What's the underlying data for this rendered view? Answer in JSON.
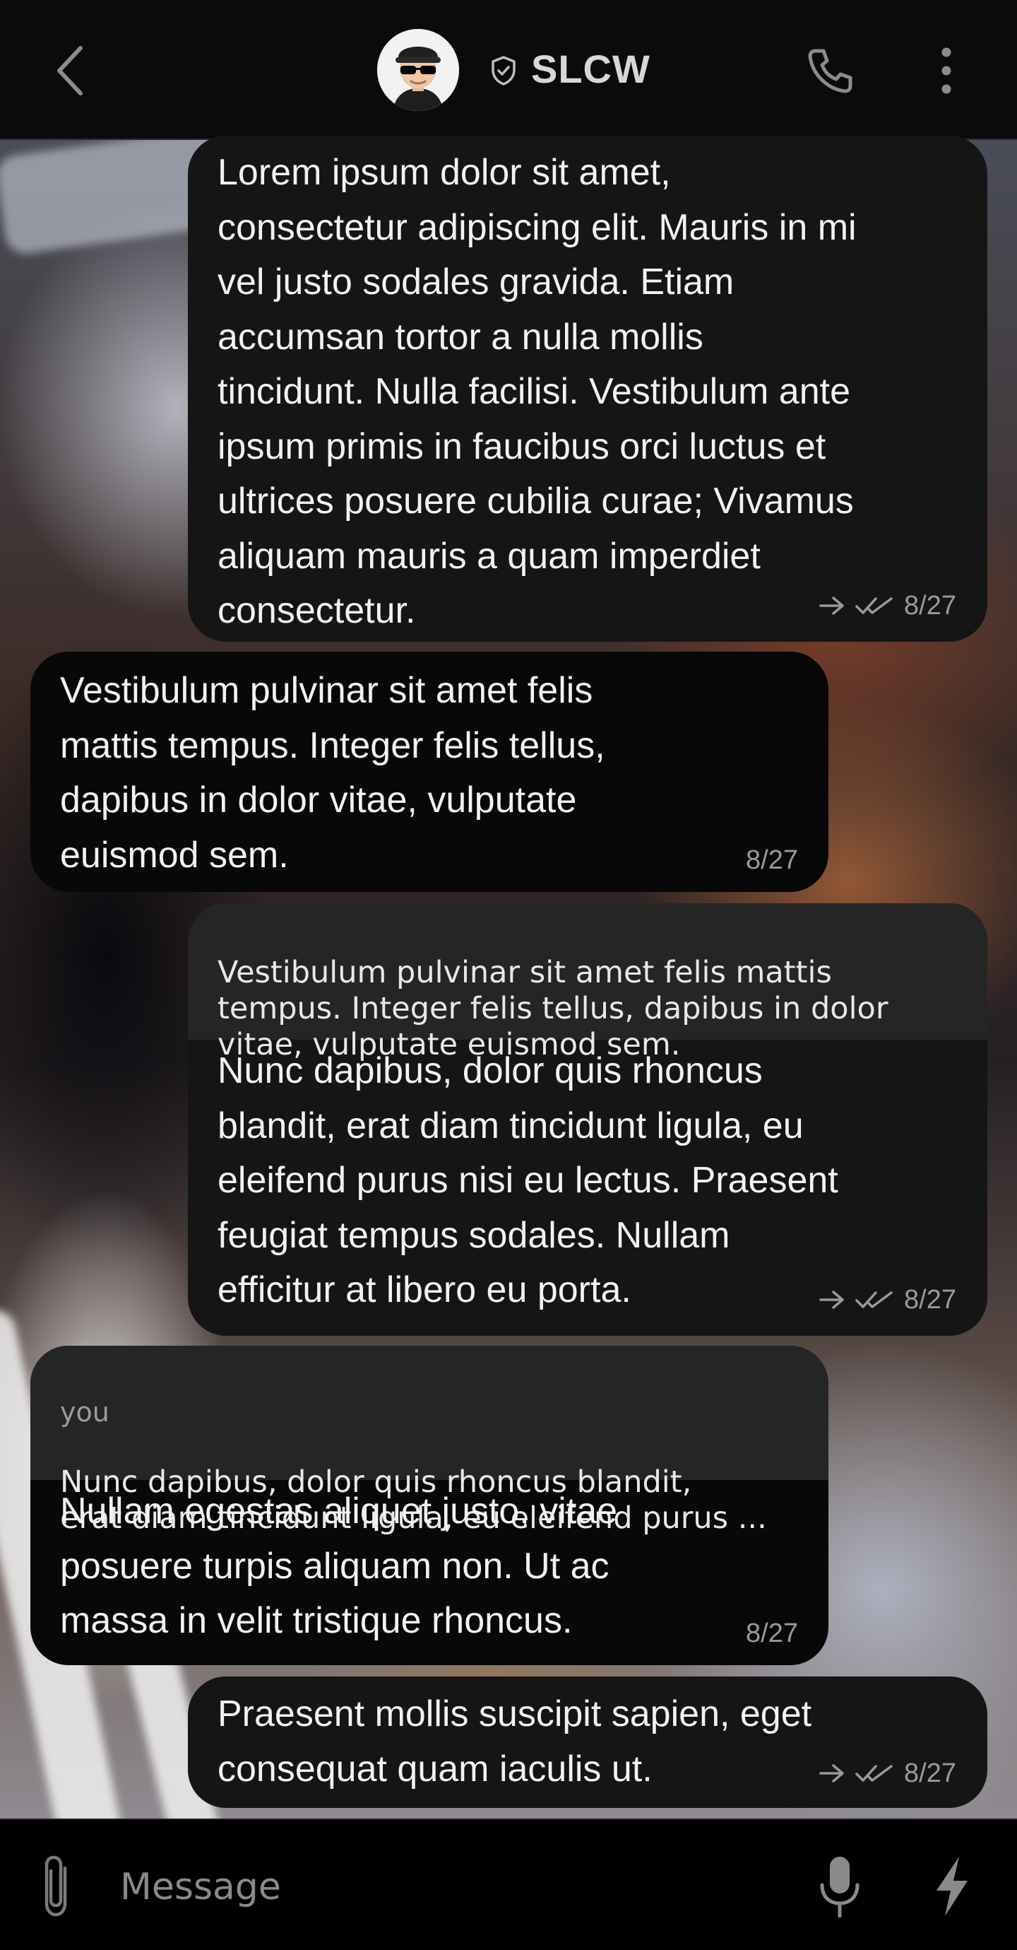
{
  "header": {
    "contact_name": "SLCW",
    "icons": {
      "back": "chevron-left-icon",
      "verified": "shield-check-icon",
      "call": "phone-icon",
      "menu": "more-vertical-icon"
    }
  },
  "messages": [
    {
      "direction": "outgoing",
      "text": "Lorem ipsum dolor sit amet,\nconsectetur adipiscing elit. Mauris in mi\nvel justo sodales gravida. Etiam\naccumsan tortor a nulla mollis\ntincidunt. Nulla facilisi. Vestibulum ante\nipsum primis in faucibus orci luctus et\nultrices posuere cubilia curae; Vivamus\naliquam mauris a quam imperdiet\nconsectetur.",
      "date": "8/27",
      "status": "read"
    },
    {
      "direction": "incoming",
      "text": "Vestibulum pulvinar sit amet felis\nmattis tempus. Integer felis tellus,\ndapibus in dolor vitae, vulputate\neuismod sem.",
      "date": "8/27"
    },
    {
      "direction": "outgoing",
      "quote": {
        "text": "Vestibulum pulvinar sit amet felis mattis\ntempus. Integer felis tellus, dapibus in dolor\nvitae, vulputate euismod sem."
      },
      "text": "Nunc dapibus, dolor quis rhoncus\nblandit, erat diam tincidunt ligula, eu\neleifend purus nisi eu lectus. Praesent\nfeugiat tempus sodales. Nullam\nefficitur at libero eu porta.",
      "date": "8/27",
      "status": "read"
    },
    {
      "direction": "incoming",
      "quote": {
        "author": "you",
        "text": "Nunc dapibus, dolor quis rhoncus blandit,\nerat diam tincidunt ligula, eu eleifend purus ..."
      },
      "text": "Nullam egestas aliquet justo, vitae\nposuere turpis aliquam non. Ut ac\nmassa in velit tristique rhoncus.",
      "date": "8/27"
    },
    {
      "direction": "outgoing",
      "text": "Praesent mollis suscipit sapien, eget\nconsequat quam iaculis ut.",
      "date": "8/27",
      "status": "read"
    }
  ],
  "composer": {
    "placeholder": "Message",
    "icons": {
      "attach": "paperclip-icon",
      "mic": "microphone-icon",
      "quick": "lightning-bolt-icon"
    }
  },
  "colors": {
    "header_bg": "#0b0b0b",
    "outgoing_bubble": "#151515",
    "incoming_bubble": "#080808",
    "quote_bg": "#252525",
    "meta_text": "#9a9a9a"
  }
}
